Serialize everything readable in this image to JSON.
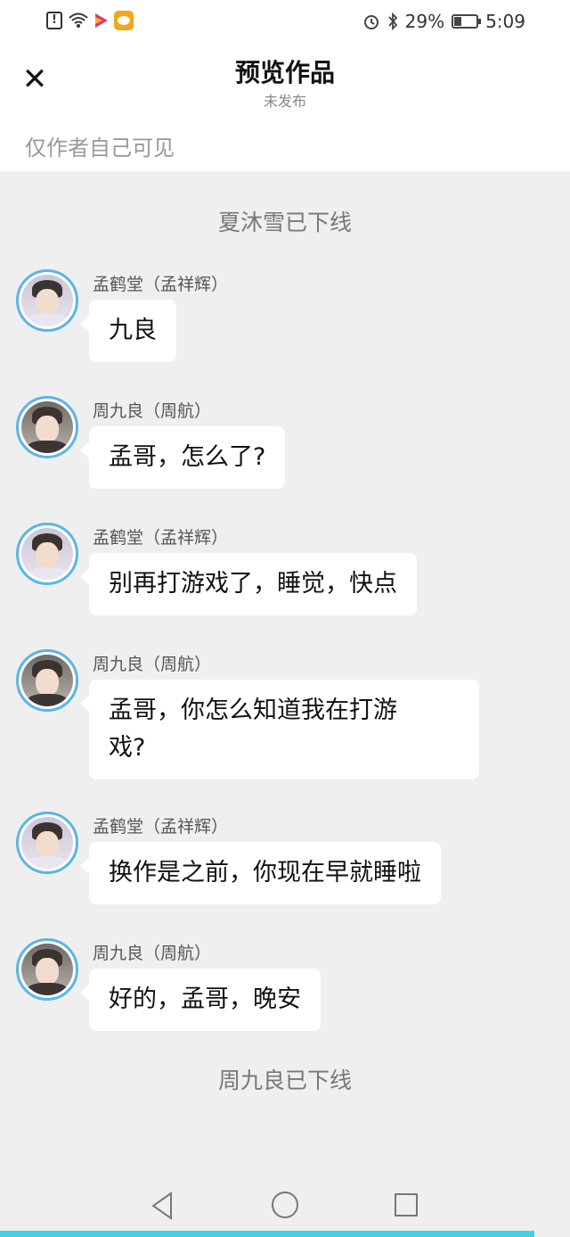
{
  "status_bar": {
    "battery_text": "29%",
    "battery_level": 0.29,
    "time": "5:09",
    "icons": [
      "alert-icon",
      "wifi-icon",
      "video-app-icon",
      "weibo-app-icon",
      "alarm-icon",
      "bluetooth-icon",
      "battery-icon"
    ]
  },
  "header": {
    "close_icon": "✕",
    "title": "预览作品",
    "subtitle": "未发布",
    "visibility": "仅作者自己可见"
  },
  "system": {
    "offline_top": "夏沐雪已下线",
    "offline_bottom": "周九良已下线"
  },
  "messages": [
    {
      "sender": "孟鹤堂（孟祥辉）",
      "text": "九良",
      "avatar": "avatar-meng"
    },
    {
      "sender": "周九良（周航）",
      "text": "孟哥，怎么了?",
      "avatar": "avatar-zhou"
    },
    {
      "sender": "孟鹤堂（孟祥辉）",
      "text": "别再打游戏了，睡觉，快点",
      "avatar": "avatar-meng"
    },
    {
      "sender": "周九良（周航）",
      "text": "孟哥，你怎么知道我在打游\n戏?",
      "avatar": "avatar-zhou"
    },
    {
      "sender": "孟鹤堂（孟祥辉）",
      "text": "换作是之前，你现在早就睡啦",
      "avatar": "avatar-meng"
    },
    {
      "sender": "周九良（周航）",
      "text": "好的，孟哥，晚安",
      "avatar": "avatar-zhou"
    }
  ],
  "colors": {
    "accent_avatar_ring": "#5ab5e8",
    "bottom_strip": "#3fd3e4",
    "chat_background": "#efefef"
  }
}
